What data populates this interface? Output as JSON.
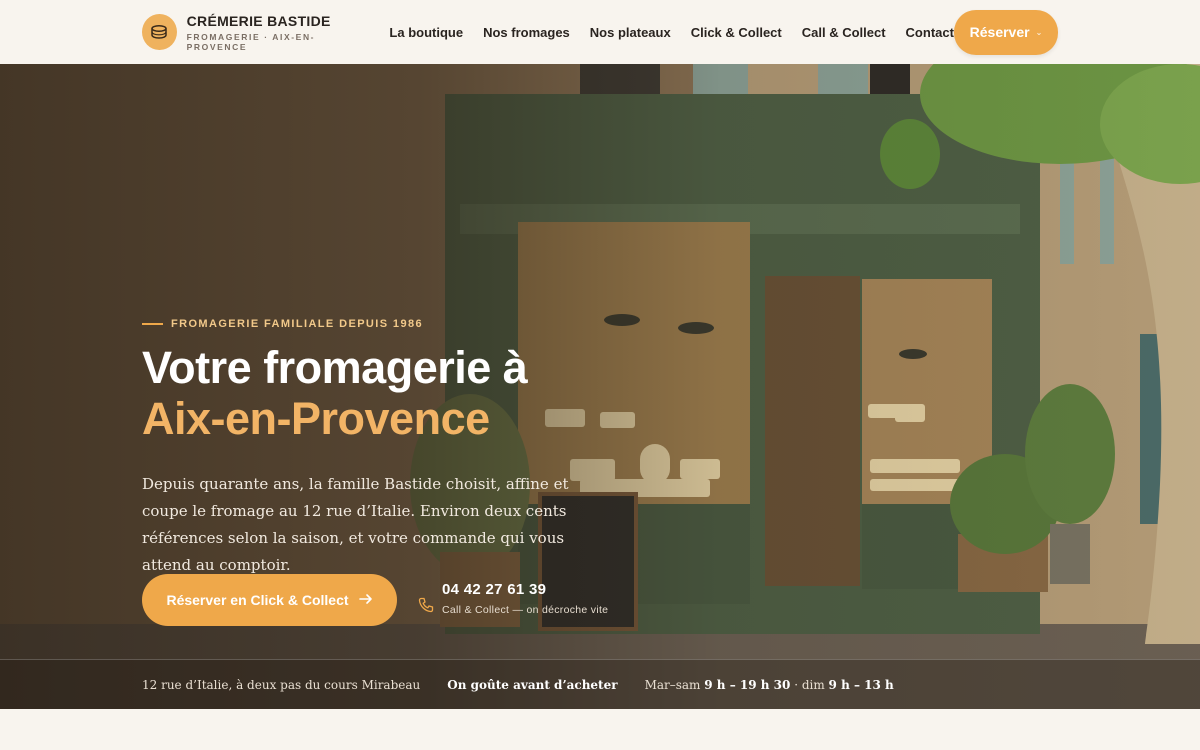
{
  "brand": {
    "title": "CRÉMERIE BASTIDE",
    "subtitle": "FROMAGERIE · AIX-EN-PROVENCE",
    "logo_icon": "cheese-wheel-icon",
    "accent_color": "#efa84a"
  },
  "nav": {
    "items": [
      "La boutique",
      "Nos fromages",
      "Nos plateaux",
      "Click & Collect",
      "Call & Collect",
      "Contact"
    ],
    "reserve_label": "Réserver"
  },
  "hero": {
    "eyebrow": "FROMAGERIE FAMILIALE DEPUIS 1986",
    "title_line1": "Votre fromagerie à",
    "title_line2": "Aix-en-Provence",
    "lead": "Depuis quarante ans, la famille Bastide choisit, affine et coupe le fromage au 12 rue d’Italie. Environ deux cents références selon la saison, et votre commande qui vous attend au comptoir.",
    "cta_label": "Réserver en Click & Collect",
    "phone_number": "04 42 27 61 39",
    "phone_caption": "Call & Collect — on décroche vite"
  },
  "info_bar": {
    "address": "12 rue d’Italie, à deux pas du cours Mirabeau",
    "tasting": "On goûte avant d’acheter",
    "hours_days1": "Mar–sam",
    "hours_time1": "9 h – 19 h 30",
    "hours_sep": "· dim",
    "hours_time2": "9 h – 13 h"
  }
}
